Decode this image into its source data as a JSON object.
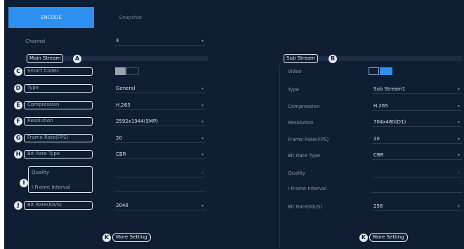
{
  "tabs": {
    "encode": "ENCODE",
    "snapshot": "Snapshot"
  },
  "channel": {
    "label": "Channel",
    "value": "4"
  },
  "main_stream": {
    "header": "Main Stream",
    "header_letter": "A",
    "rows": [
      {
        "letter": "C",
        "label": "Smart Codec",
        "value": ""
      },
      {
        "letter": "D",
        "label": "Type",
        "value": "General"
      },
      {
        "letter": "E",
        "label": "Compression",
        "value": "H.265"
      },
      {
        "letter": "F",
        "label": "Resolution",
        "value": "2592x1944(5MP)"
      },
      {
        "letter": "G",
        "label": "Frame Rate(FPS)",
        "value": "20"
      },
      {
        "letter": "H",
        "label": "Bit Rate Type",
        "value": "CBR"
      },
      {
        "letter": "I",
        "label": "Quality",
        "value": ""
      },
      {
        "letter": "I",
        "label": "I Frame Interval",
        "value": ""
      },
      {
        "letter": "J",
        "label": "Bit Rate(Kb/S)",
        "value": "2048"
      }
    ],
    "more_letter": "K",
    "more_label": "More Setting"
  },
  "sub_stream": {
    "header": "Sub Stream",
    "header_letter": "B",
    "rows": [
      {
        "label": "Video",
        "value": ""
      },
      {
        "label": "Type",
        "value": "Sub Stream1"
      },
      {
        "label": "Compression",
        "value": "H.265"
      },
      {
        "label": "Resolution",
        "value": "704x480(D1)"
      },
      {
        "label": "Frame Rate(FPS)",
        "value": "20"
      },
      {
        "label": "Bit Rate Type",
        "value": "CBR"
      },
      {
        "label": "Quality",
        "value": ""
      },
      {
        "label": "I Frame Interval",
        "value": ""
      },
      {
        "label": "Bit Rate(Kb/S)",
        "value": "256"
      }
    ],
    "more_letter": "K",
    "more_label": "More Setting"
  },
  "icons": {
    "dropdown": "chevron-down-icon"
  },
  "colors": {
    "accent": "#2d8ff0",
    "background": "#0f1e33",
    "callout": "#e6ebf1"
  }
}
